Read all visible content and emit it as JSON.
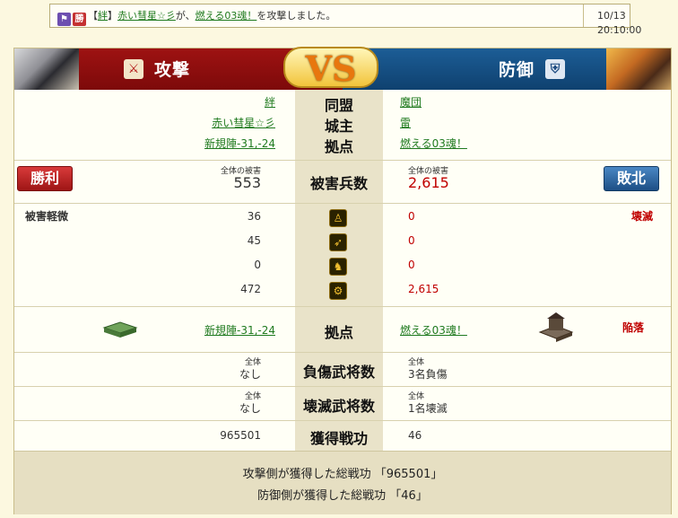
{
  "log": {
    "icon1": "flag-icon",
    "icon2_label": "勝",
    "bracket_open": "【",
    "alliance": "絆",
    "bracket_close": "】",
    "attacker": "赤い彗星☆彡",
    "text_ga": "が、",
    "target": "燃える03魂！",
    "text_tail": "を攻撃しました。",
    "timestamp": "10/13 20:10:00"
  },
  "banner": {
    "attack_title": "攻撃",
    "defense_title": "防御",
    "vs": "VS"
  },
  "info": {
    "alliance_label": "同盟",
    "lord_label": "城主",
    "base_label": "拠点",
    "atk_alliance": "絆",
    "def_alliance": "魔団",
    "atk_lord": "赤い彗星☆彡",
    "def_lord": "雷",
    "atk_base": "新規陣-31,-24",
    "def_base": "燃える03魂！"
  },
  "damage": {
    "label": "被害兵数",
    "total_caption": "全体の被害",
    "atk_total": "553",
    "def_total": "2,615",
    "win": "勝利",
    "lose": "敗北"
  },
  "units": {
    "atk_status": "被害軽微",
    "def_status": "壊滅",
    "rows": [
      {
        "atk": "36",
        "def": "0",
        "icon": "spear-icon",
        "glyph": "♙"
      },
      {
        "atk": "45",
        "def": "0",
        "icon": "bow-icon",
        "glyph": "➶"
      },
      {
        "atk": "0",
        "def": "0",
        "icon": "horse-icon",
        "glyph": "♞"
      },
      {
        "atk": "472",
        "def": "2,615",
        "icon": "siege-icon",
        "glyph": "⚙"
      }
    ]
  },
  "base_row": {
    "label": "拠点",
    "atk_base": "新規陣-31,-24",
    "def_base": "燃える03魂！",
    "def_status": "陥落"
  },
  "wounded": {
    "label": "負傷武将数",
    "caption": "全体",
    "atk": "なし",
    "def": "3名負傷"
  },
  "destroyed": {
    "label": "壊滅武将数",
    "caption": "全体",
    "atk": "なし",
    "def": "1名壊滅"
  },
  "merit": {
    "label": "獲得戦功",
    "atk": "965501",
    "def": "46"
  },
  "footer": {
    "line1": "攻撃側が獲得した総戦功 「965501」",
    "line2": "防御側が獲得した総戦功 「46」"
  }
}
